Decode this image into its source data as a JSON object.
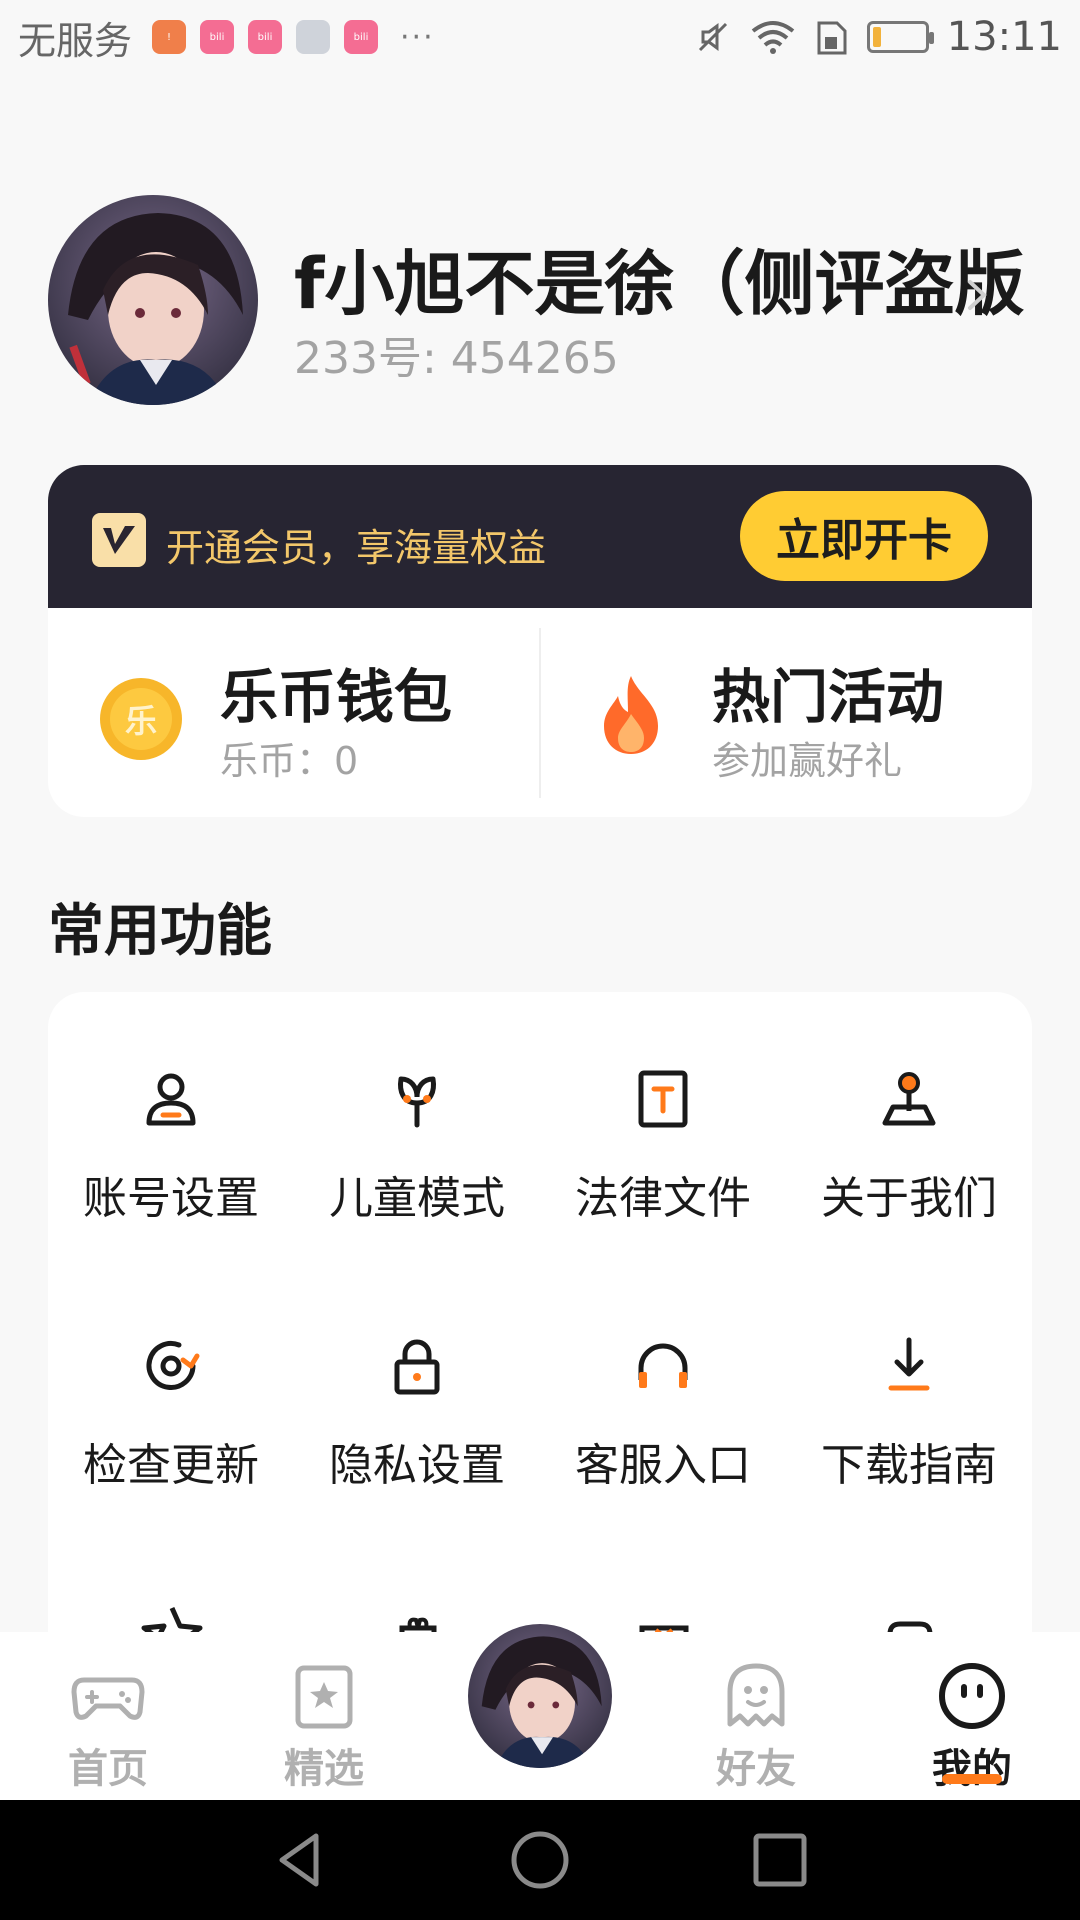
{
  "status_bar": {
    "carrier": "无服务",
    "apps": [
      "orange-app",
      "bilibili",
      "bilibili",
      "anime-app",
      "bilibili"
    ],
    "more": "···",
    "time": "13:11"
  },
  "profile": {
    "name": "f小旭不是徐（侧评盗版",
    "id_text": "233号: 454265"
  },
  "vip": {
    "text": "开通会员，享海量权益",
    "button": "立即开卡",
    "coin_glyph": "乐"
  },
  "wallet": {
    "title": "乐币钱包",
    "sub": "乐币：0"
  },
  "activity": {
    "title": "热门活动",
    "sub": "参加赢好礼"
  },
  "section": {
    "title": "常用功能"
  },
  "functions": [
    {
      "label": "账号设置",
      "icon": "user-icon"
    },
    {
      "label": "儿童模式",
      "icon": "sprout-icon"
    },
    {
      "label": "法律文件",
      "icon": "document-icon"
    },
    {
      "label": "关于我们",
      "icon": "joystick-icon"
    },
    {
      "label": "检查更新",
      "icon": "refresh-icon"
    },
    {
      "label": "隐私设置",
      "icon": "lock-icon"
    },
    {
      "label": "客服入口",
      "icon": "headphones-icon"
    },
    {
      "label": "下载指南",
      "icon": "download-icon"
    }
  ],
  "bottom_nav": [
    {
      "label": "首页",
      "icon": "gamepad-icon"
    },
    {
      "label": "精选",
      "icon": "star-card-icon"
    },
    {
      "label": "",
      "icon": "avatar"
    },
    {
      "label": "好友",
      "icon": "ghost-icon"
    },
    {
      "label": "我的",
      "icon": "face-icon",
      "active": true
    }
  ],
  "colors": {
    "accent": "#ff7a1a",
    "vip_bar": "#272532",
    "vip_button": "#ffcc33",
    "vip_text": "#f3c76a"
  }
}
